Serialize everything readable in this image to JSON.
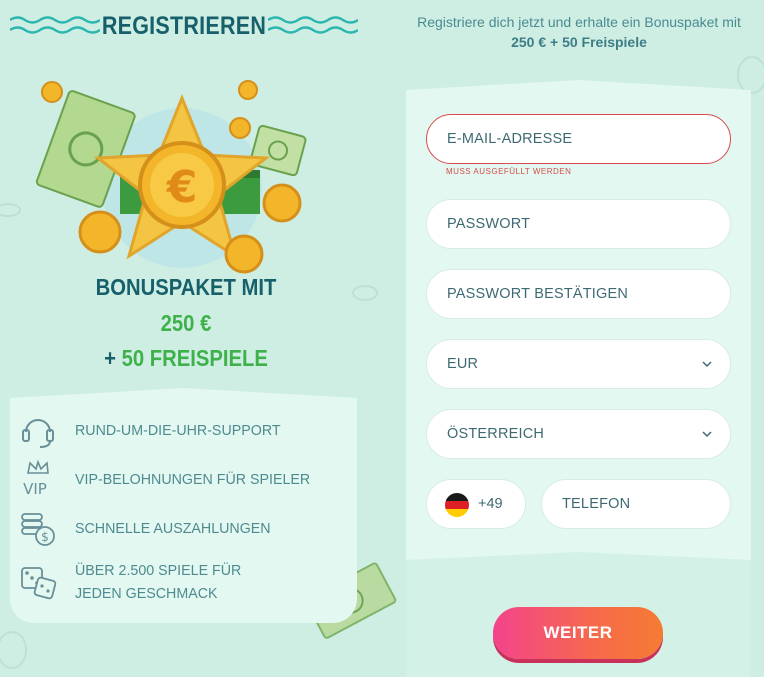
{
  "header": {
    "title": "REGISTRIEREN",
    "promo_prefix": "Registriere dich jetzt und erhalte ein Bonuspaket mit ",
    "promo_bold": "250 € + 50 Freispiele"
  },
  "bonus": {
    "line1": "BONUSPAKET MIT",
    "line2": "250 €",
    "line3_plus": "+ ",
    "line3_free": "50 FREISPIELE"
  },
  "features": [
    {
      "icon": "headset-icon",
      "text": "RUND-UM-DIE-UHR-SUPPORT"
    },
    {
      "icon": "vip-crown-icon",
      "text": "VIP-BELOHNUNGEN FÜR SPIELER",
      "icon_text": "VIP"
    },
    {
      "icon": "coin-stack-icon",
      "text": "SCHNELLE AUSZAHLUNGEN"
    },
    {
      "icon": "dice-icon",
      "text": "ÜBER 2.500 SPIELE FÜR JEDEN GESCHMACK"
    }
  ],
  "form": {
    "email_placeholder": "E-MAIL-ADRESSE",
    "email_error": "MUSS AUSGEFÜLLT WERDEN",
    "password_placeholder": "PASSWORT",
    "password_confirm_placeholder": "PASSWORT BESTÄTIGEN",
    "currency_selected": "EUR",
    "country_selected": "ÖSTERREICH",
    "phone_code": "+49",
    "phone_placeholder": "TELEFON",
    "submit_label": "WEITER"
  },
  "colors": {
    "background": "#cfeee3",
    "card": "#e2f8f0",
    "title": "#17606b",
    "accent_green": "#3fb14a",
    "error": "#d84b4b",
    "button_start": "#f3438c",
    "button_end": "#f57b33"
  }
}
